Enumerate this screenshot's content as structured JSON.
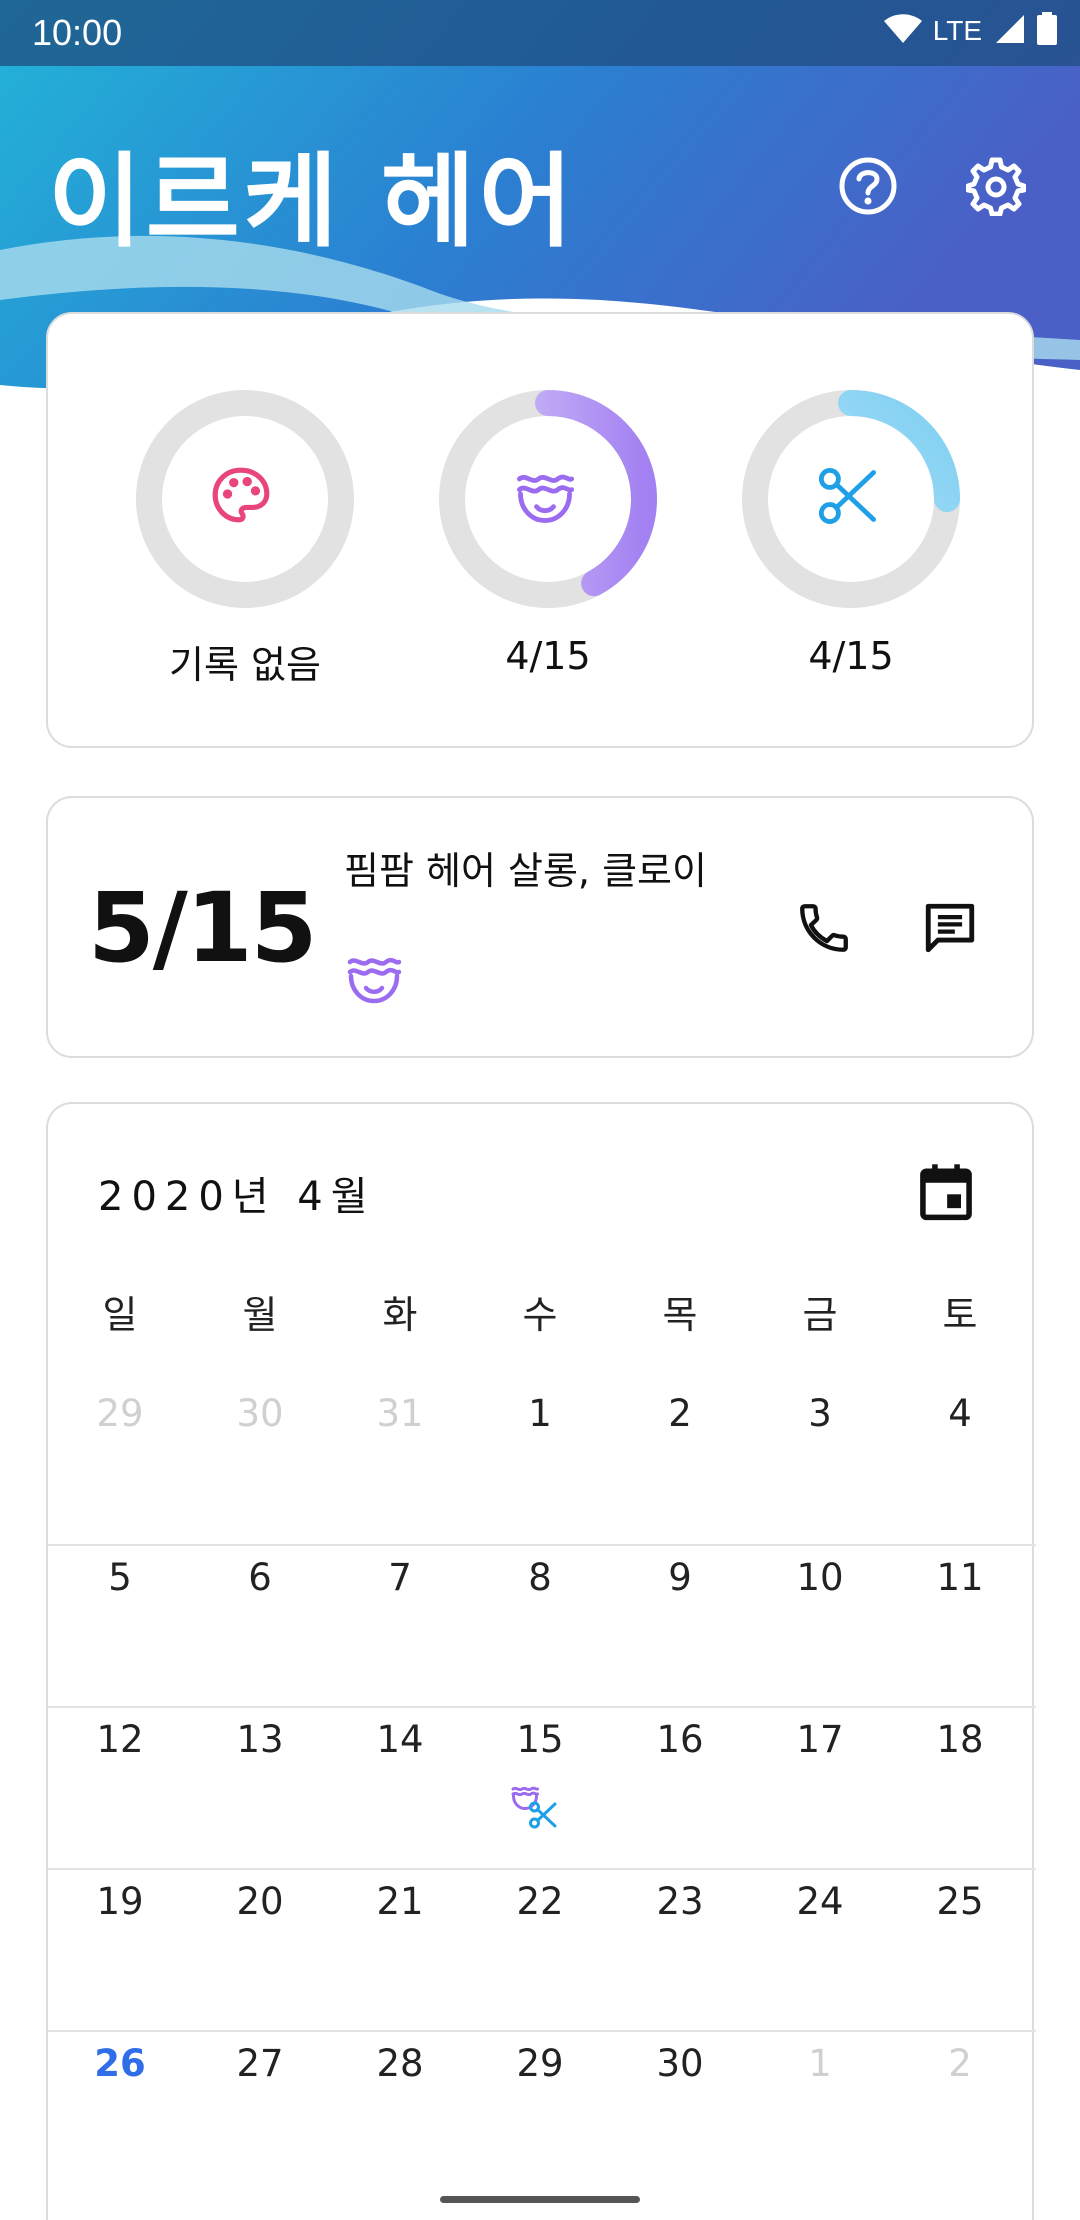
{
  "status_bar": {
    "time": "10:00",
    "network": "LTE"
  },
  "app": {
    "title": "이르케 헤어"
  },
  "summary": {
    "items": [
      {
        "key": "dye",
        "icon": "palette-icon",
        "label": "기록 없음",
        "progress": 0,
        "color": "#e8457a"
      },
      {
        "key": "perm",
        "icon": "perm-face-icon",
        "label": "4/15",
        "progress": 0.42,
        "color": "#9b6bf0"
      },
      {
        "key": "cut",
        "icon": "scissors-icon",
        "label": "4/15",
        "progress": 0.25,
        "color": "#2aa8e8"
      }
    ]
  },
  "next_appointment": {
    "date": "5/15",
    "salon": "핌팜 헤어 살롱, 클로이",
    "service_icon": "perm-face-icon"
  },
  "calendar": {
    "header": "2020년 4월",
    "weekdays": [
      "일",
      "월",
      "화",
      "수",
      "목",
      "금",
      "토"
    ],
    "weeks": [
      [
        {
          "d": "29",
          "m": true
        },
        {
          "d": "30",
          "m": true
        },
        {
          "d": "31",
          "m": true
        },
        {
          "d": "1"
        },
        {
          "d": "2"
        },
        {
          "d": "3"
        },
        {
          "d": "4"
        }
      ],
      [
        {
          "d": "5"
        },
        {
          "d": "6"
        },
        {
          "d": "7"
        },
        {
          "d": "8"
        },
        {
          "d": "9"
        },
        {
          "d": "10"
        },
        {
          "d": "11"
        }
      ],
      [
        {
          "d": "12"
        },
        {
          "d": "13"
        },
        {
          "d": "14"
        },
        {
          "d": "15",
          "marks": [
            "perm",
            "cut"
          ]
        },
        {
          "d": "16"
        },
        {
          "d": "17"
        },
        {
          "d": "18"
        }
      ],
      [
        {
          "d": "19"
        },
        {
          "d": "20"
        },
        {
          "d": "21"
        },
        {
          "d": "22"
        },
        {
          "d": "23"
        },
        {
          "d": "24"
        },
        {
          "d": "25"
        }
      ],
      [
        {
          "d": "26",
          "today": true
        },
        {
          "d": "27"
        },
        {
          "d": "28"
        },
        {
          "d": "29"
        },
        {
          "d": "30"
        },
        {
          "d": "1",
          "m": true
        },
        {
          "d": "2",
          "m": true
        }
      ]
    ]
  },
  "colors": {
    "accent": "#2f6ee8",
    "perm": "#9b6bf0",
    "cut": "#2aa8e8",
    "dye": "#e8457a"
  }
}
